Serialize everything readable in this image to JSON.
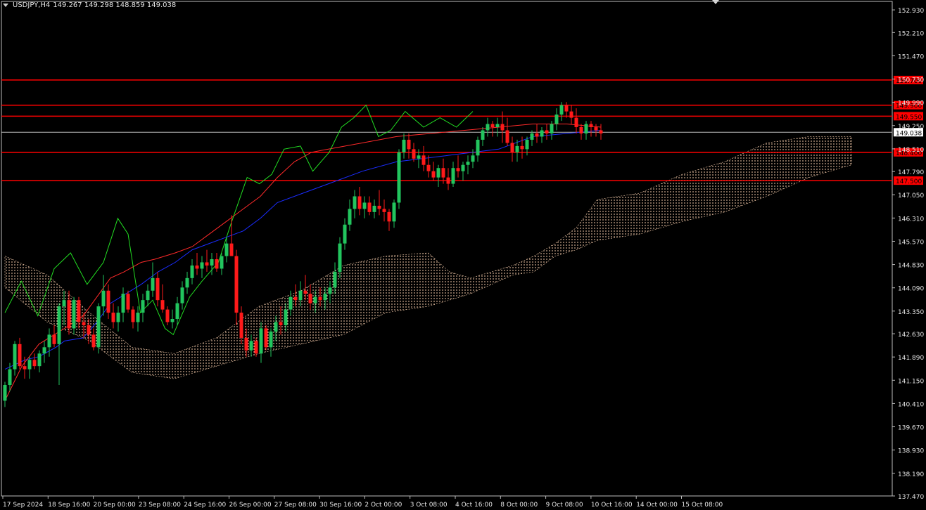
{
  "header": {
    "symbol": "USDJPY,H4",
    "ohlc": "149.267 149.298 148.859 149.038"
  },
  "colors": {
    "background": "#000000",
    "axis": "#e6e6e6",
    "bull": "#22c55e",
    "bear": "#ff1a1a",
    "tenkan": "#ff2a2a",
    "kijun": "#1a2cff",
    "chikou": "#22dd22",
    "cloud": "#f2c9a8",
    "level": "#ff0000",
    "price_line": "#c0c0c0"
  },
  "chart_data": {
    "type": "candlestick",
    "symbol": "USDJPY",
    "timeframe": "H4",
    "y_range": [
      137.47,
      153.2
    ],
    "y_ticks": [
      "152.930",
      "152.210",
      "151.470",
      "150.730",
      "149.990",
      "149.250",
      "148.510",
      "147.790",
      "147.050",
      "146.310",
      "145.570",
      "144.830",
      "144.090",
      "143.350",
      "142.630",
      "141.890",
      "141.150",
      "140.410",
      "139.670",
      "138.930",
      "138.190",
      "137.470"
    ],
    "x_ticks": [
      "17 Sep 2024",
      "18 Sep 16:00",
      "20 Sep 00:00",
      "23 Sep 08:00",
      "24 Sep 16:00",
      "26 Sep 00:00",
      "27 Sep 08:00",
      "30 Sep 16:00",
      "2 Oct 00:00",
      "3 Oct 08:00",
      "4 Oct 16:00",
      "8 Oct 00:00",
      "9 Oct 08:00",
      "10 Oct 16:00",
      "14 Oct 00:00",
      "15 Oct 08:00"
    ],
    "levels": [
      {
        "label": "150.700",
        "value": 150.7
      },
      {
        "label": "149.900",
        "value": 149.9
      },
      {
        "label": "149.550",
        "value": 149.55
      },
      {
        "label": "148.400",
        "value": 148.4
      },
      {
        "label": "147.500",
        "value": 147.5
      }
    ],
    "current_price": {
      "label": "149.038",
      "value": 149.038
    },
    "candle_spacing": 7.0,
    "first_candle_x": 7,
    "candles": [
      [
        140.5,
        141.1,
        140.3,
        141.0
      ],
      [
        141.0,
        141.7,
        140.8,
        141.5
      ],
      [
        141.5,
        142.4,
        141.3,
        142.3
      ],
      [
        142.3,
        142.5,
        141.5,
        141.6
      ],
      [
        141.6,
        141.9,
        141.2,
        141.5
      ],
      [
        141.5,
        141.9,
        141.2,
        141.8
      ],
      [
        141.8,
        142.0,
        141.5,
        141.6
      ],
      [
        141.6,
        142.1,
        141.4,
        142.0
      ],
      [
        142.0,
        142.4,
        141.7,
        142.2
      ],
      [
        142.2,
        142.8,
        141.9,
        142.6
      ],
      [
        142.6,
        142.9,
        142.2,
        142.3
      ],
      [
        142.3,
        143.6,
        141.0,
        143.5
      ],
      [
        143.5,
        144.0,
        142.9,
        143.7
      ],
      [
        143.7,
        144.0,
        142.6,
        142.8
      ],
      [
        142.8,
        143.8,
        142.6,
        143.7
      ],
      [
        143.7,
        143.8,
        142.8,
        143.0
      ],
      [
        143.0,
        143.3,
        142.5,
        142.9
      ],
      [
        142.9,
        143.1,
        142.3,
        142.6
      ],
      [
        142.6,
        142.8,
        142.1,
        142.2
      ],
      [
        142.2,
        143.6,
        142.0,
        143.5
      ],
      [
        143.5,
        144.5,
        143.2,
        144.0
      ],
      [
        144.0,
        144.2,
        143.1,
        143.3
      ],
      [
        143.3,
        143.6,
        142.8,
        143.0
      ],
      [
        143.0,
        143.5,
        142.7,
        143.3
      ],
      [
        143.3,
        144.1,
        143.0,
        143.9
      ],
      [
        143.9,
        144.0,
        143.3,
        143.4
      ],
      [
        143.4,
        143.5,
        142.8,
        143.0
      ],
      [
        143.0,
        143.5,
        142.7,
        143.3
      ],
      [
        143.3,
        143.9,
        143.0,
        143.7
      ],
      [
        143.7,
        144.2,
        143.5,
        144.0
      ],
      [
        144.0,
        144.9,
        143.8,
        144.4
      ],
      [
        144.4,
        144.6,
        143.5,
        143.7
      ],
      [
        143.7,
        144.2,
        143.3,
        143.4
      ],
      [
        143.4,
        143.5,
        142.9,
        143.0
      ],
      [
        143.0,
        143.4,
        142.8,
        143.1
      ],
      [
        143.1,
        143.8,
        142.9,
        143.6
      ],
      [
        143.6,
        144.3,
        143.4,
        144.1
      ],
      [
        144.1,
        144.6,
        143.9,
        144.4
      ],
      [
        144.4,
        145.0,
        144.2,
        144.8
      ],
      [
        144.8,
        145.2,
        144.5,
        144.7
      ],
      [
        144.7,
        145.1,
        144.4,
        144.9
      ],
      [
        144.9,
        145.3,
        144.6,
        144.8
      ],
      [
        144.8,
        145.2,
        144.5,
        145.0
      ],
      [
        145.0,
        145.2,
        144.6,
        144.7
      ],
      [
        144.7,
        145.2,
        144.5,
        145.1
      ],
      [
        145.1,
        145.7,
        144.9,
        145.5
      ],
      [
        145.5,
        146.4,
        145.3,
        145.1
      ],
      [
        145.1,
        145.3,
        142.9,
        143.3
      ],
      [
        143.3,
        143.5,
        142.3,
        142.5
      ],
      [
        142.5,
        142.8,
        141.9,
        142.1
      ],
      [
        142.1,
        142.6,
        141.9,
        142.4
      ],
      [
        142.4,
        142.5,
        141.9,
        142.0
      ],
      [
        142.0,
        143.0,
        141.7,
        142.8
      ],
      [
        142.8,
        142.9,
        142.1,
        142.2
      ],
      [
        142.2,
        142.8,
        141.9,
        142.7
      ],
      [
        142.7,
        143.2,
        142.4,
        143.0
      ],
      [
        143.0,
        143.5,
        142.6,
        142.9
      ],
      [
        142.9,
        143.6,
        142.7,
        143.4
      ],
      [
        143.4,
        144.0,
        143.2,
        143.8
      ],
      [
        143.8,
        144.2,
        143.5,
        143.7
      ],
      [
        143.7,
        144.3,
        143.5,
        144.0
      ],
      [
        144.0,
        144.5,
        143.7,
        143.9
      ],
      [
        143.9,
        144.2,
        143.4,
        143.6
      ],
      [
        143.6,
        144.0,
        143.3,
        143.8
      ],
      [
        143.8,
        144.1,
        143.5,
        143.7
      ],
      [
        143.7,
        144.1,
        143.4,
        143.9
      ],
      [
        143.9,
        144.3,
        143.6,
        144.1
      ],
      [
        144.1,
        144.9,
        143.9,
        144.6
      ],
      [
        144.6,
        145.7,
        144.4,
        145.5
      ],
      [
        145.5,
        146.3,
        145.3,
        146.1
      ],
      [
        146.1,
        146.9,
        145.9,
        146.6
      ],
      [
        146.6,
        147.2,
        146.3,
        147.0
      ],
      [
        147.0,
        147.3,
        146.4,
        146.6
      ],
      [
        146.6,
        147.0,
        146.3,
        146.8
      ],
      [
        146.8,
        147.0,
        146.4,
        146.5
      ],
      [
        146.5,
        146.9,
        146.3,
        146.7
      ],
      [
        146.7,
        147.2,
        146.4,
        146.6
      ],
      [
        146.6,
        146.9,
        146.2,
        146.5
      ],
      [
        146.5,
        146.6,
        145.9,
        146.2
      ],
      [
        146.2,
        146.9,
        146.0,
        146.8
      ],
      [
        146.8,
        148.5,
        146.6,
        148.4
      ],
      [
        148.4,
        149.0,
        148.2,
        148.8
      ],
      [
        148.8,
        149.0,
        148.2,
        148.5
      ],
      [
        148.5,
        148.7,
        148.1,
        148.2
      ],
      [
        148.2,
        148.5,
        147.9,
        148.3
      ],
      [
        148.3,
        148.6,
        147.8,
        148.0
      ],
      [
        148.0,
        148.3,
        147.6,
        147.8
      ],
      [
        147.8,
        148.1,
        147.5,
        147.6
      ],
      [
        147.6,
        148.0,
        147.3,
        147.9
      ],
      [
        147.9,
        148.2,
        147.4,
        147.6
      ],
      [
        147.6,
        147.9,
        147.2,
        147.4
      ],
      [
        147.4,
        148.1,
        147.3,
        147.9
      ],
      [
        147.9,
        148.3,
        147.6,
        147.8
      ],
      [
        147.8,
        148.1,
        147.5,
        148.0
      ],
      [
        148.0,
        148.3,
        147.7,
        148.1
      ],
      [
        148.1,
        148.5,
        147.9,
        148.3
      ],
      [
        148.3,
        148.9,
        148.1,
        148.8
      ],
      [
        148.8,
        149.2,
        148.6,
        149.1
      ],
      [
        149.1,
        149.5,
        148.9,
        149.3
      ],
      [
        149.3,
        149.4,
        148.9,
        149.2
      ],
      [
        149.2,
        149.5,
        148.9,
        149.3
      ],
      [
        149.3,
        149.7,
        148.7,
        149.1
      ],
      [
        149.1,
        149.5,
        148.6,
        148.7
      ],
      [
        148.7,
        148.9,
        148.1,
        148.4
      ],
      [
        148.4,
        148.8,
        148.1,
        148.6
      ],
      [
        148.6,
        148.9,
        148.2,
        148.5
      ],
      [
        148.5,
        148.9,
        148.3,
        148.8
      ],
      [
        148.8,
        149.1,
        148.6,
        149.0
      ],
      [
        149.0,
        149.3,
        148.7,
        148.9
      ],
      [
        148.9,
        149.2,
        148.7,
        149.1
      ],
      [
        149.1,
        149.3,
        148.8,
        149.0
      ],
      [
        149.0,
        149.4,
        148.8,
        149.3
      ],
      [
        149.3,
        149.8,
        149.1,
        149.6
      ],
      [
        149.6,
        150.0,
        149.4,
        149.9
      ],
      [
        149.9,
        150.0,
        149.5,
        149.7
      ],
      [
        149.7,
        149.9,
        149.3,
        149.5
      ],
      [
        149.5,
        149.8,
        149.0,
        149.2
      ],
      [
        149.2,
        149.3,
        148.8,
        149.0
      ],
      [
        149.0,
        149.4,
        148.8,
        149.3
      ],
      [
        149.3,
        149.4,
        148.9,
        149.2
      ],
      [
        149.2,
        149.3,
        148.9,
        149.1
      ],
      [
        149.1,
        149.3,
        148.8,
        149.0
      ]
    ],
    "kijun": [
      [
        0,
        141.5
      ],
      [
        12,
        141.8
      ],
      [
        20,
        141.9
      ],
      [
        30,
        142.2
      ],
      [
        35,
        142.4
      ],
      [
        46,
        142.5
      ],
      [
        54,
        143.0
      ],
      [
        62,
        143.6
      ],
      [
        80,
        144.2
      ],
      [
        90,
        144.6
      ],
      [
        100,
        144.9
      ],
      [
        110,
        145.3
      ],
      [
        120,
        145.5
      ],
      [
        130,
        145.7
      ],
      [
        140,
        145.9
      ],
      [
        150,
        146.3
      ],
      [
        160,
        146.8
      ],
      [
        175,
        147.1
      ],
      [
        190,
        147.4
      ],
      [
        210,
        147.8
      ],
      [
        230,
        148.1
      ],
      [
        260,
        148.3
      ],
      [
        290,
        148.5
      ],
      [
        310,
        148.9
      ],
      [
        330,
        149.0
      ],
      [
        350,
        149.1
      ]
    ],
    "tenkan": [
      [
        0,
        140.5
      ],
      [
        10,
        141.6
      ],
      [
        20,
        142.3
      ],
      [
        35,
        142.8
      ],
      [
        46,
        143.2
      ],
      [
        54,
        143.8
      ],
      [
        62,
        144.4
      ],
      [
        70,
        144.6
      ],
      [
        80,
        144.9
      ],
      [
        88,
        145.0
      ],
      [
        100,
        145.2
      ],
      [
        110,
        145.4
      ],
      [
        120,
        145.8
      ],
      [
        130,
        146.2
      ],
      [
        140,
        146.6
      ],
      [
        150,
        147.0
      ],
      [
        160,
        147.6
      ],
      [
        170,
        148.1
      ],
      [
        180,
        148.4
      ],
      [
        190,
        148.5
      ],
      [
        210,
        148.7
      ],
      [
        230,
        148.9
      ],
      [
        250,
        149.0
      ],
      [
        270,
        149.1
      ],
      [
        290,
        149.2
      ],
      [
        310,
        149.3
      ],
      [
        330,
        149.3
      ],
      [
        350,
        149.2
      ]
    ],
    "chikou": [
      [
        0,
        143.3
      ],
      [
        8,
        144.3
      ],
      [
        16,
        143.2
      ],
      [
        24,
        144.7
      ],
      [
        32,
        145.2
      ],
      [
        40,
        144.2
      ],
      [
        48,
        144.9
      ],
      [
        55,
        146.3
      ],
      [
        60,
        145.8
      ],
      [
        66,
        143.3
      ],
      [
        72,
        143.7
      ],
      [
        78,
        142.8
      ],
      [
        82,
        142.6
      ],
      [
        90,
        143.8
      ],
      [
        96,
        144.3
      ],
      [
        104,
        144.9
      ],
      [
        110,
        146.1
      ],
      [
        118,
        147.6
      ],
      [
        124,
        147.4
      ],
      [
        130,
        147.7
      ],
      [
        136,
        148.5
      ],
      [
        144,
        148.6
      ],
      [
        150,
        147.8
      ],
      [
        158,
        148.4
      ],
      [
        164,
        149.2
      ],
      [
        170,
        149.5
      ],
      [
        176,
        149.9
      ],
      [
        182,
        148.9
      ],
      [
        188,
        149.1
      ],
      [
        195,
        149.7
      ],
      [
        204,
        149.2
      ],
      [
        212,
        149.5
      ],
      [
        220,
        149.2
      ],
      [
        228,
        149.7
      ]
    ],
    "cloud_top": [
      [
        0,
        145.1
      ],
      [
        20,
        144.5
      ],
      [
        40,
        143.3
      ],
      [
        60,
        142.2
      ],
      [
        80,
        142.0
      ],
      [
        100,
        142.5
      ],
      [
        120,
        143.5
      ],
      [
        140,
        144.0
      ],
      [
        160,
        144.8
      ],
      [
        180,
        145.1
      ],
      [
        200,
        145.2
      ],
      [
        210,
        144.6
      ],
      [
        220,
        144.4
      ],
      [
        230,
        144.6
      ],
      [
        240,
        144.8
      ],
      [
        250,
        145.1
      ],
      [
        260,
        145.5
      ],
      [
        270,
        146.0
      ],
      [
        280,
        146.9
      ],
      [
        300,
        147.1
      ],
      [
        320,
        147.7
      ],
      [
        340,
        148.1
      ],
      [
        360,
        148.7
      ],
      [
        380,
        148.9
      ],
      [
        400,
        148.9
      ]
    ],
    "cloud_bottom": [
      [
        0,
        144.1
      ],
      [
        20,
        143.0
      ],
      [
        40,
        142.4
      ],
      [
        60,
        141.4
      ],
      [
        80,
        141.2
      ],
      [
        100,
        141.6
      ],
      [
        120,
        142.0
      ],
      [
        140,
        142.3
      ],
      [
        160,
        142.6
      ],
      [
        180,
        143.3
      ],
      [
        200,
        143.5
      ],
      [
        210,
        143.7
      ],
      [
        220,
        143.9
      ],
      [
        230,
        144.2
      ],
      [
        240,
        144.5
      ],
      [
        250,
        144.6
      ],
      [
        260,
        145.1
      ],
      [
        270,
        145.3
      ],
      [
        280,
        145.6
      ],
      [
        300,
        145.8
      ],
      [
        320,
        146.2
      ],
      [
        340,
        146.5
      ],
      [
        360,
        147.0
      ],
      [
        380,
        147.6
      ],
      [
        400,
        148.0
      ]
    ]
  }
}
